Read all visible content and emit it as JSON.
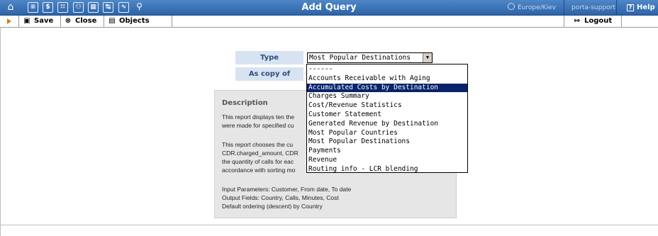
{
  "topbar": {
    "title": "Add Query",
    "timezone": "Europe/Kiev",
    "user": "porta-support",
    "help_label": "Help",
    "nav_icons": [
      "home-icon",
      "list-icon",
      "dollar-icon",
      "grid-icon",
      "user-icon",
      "table-icon",
      "transfer-icon",
      "chart-icon",
      "search-icon"
    ]
  },
  "toolbar": {
    "save_label": "Save",
    "close_label": "Close",
    "objects_label": "Objects",
    "logout_label": "Logout"
  },
  "form": {
    "type_label": "Type",
    "as_copy_label": "As copy of",
    "type_value": "Most Popular Destinations"
  },
  "dropdown": {
    "options": [
      "------",
      "Accounts Receivable with Aging",
      "Accumulated Costs by Destination",
      "Charges Summary",
      "Cost/Revenue Statistics",
      "Customer Statement",
      "Generated Revenue by Destination",
      "Most Popular Countries",
      "Most Popular Destinations",
      "Payments",
      "Revenue",
      "Routing info - LCR blending"
    ],
    "highlighted": "Accumulated Costs by Destination"
  },
  "description": {
    "title": "Description",
    "lines": [
      "This report displays ten the",
      "were made for specified cu",
      "",
      "This report chooses the cu",
      "CDR.charged_amount, CDR",
      "the quantity of calls for eac",
      "accordance with sorting mo",
      "",
      "Input Parameters: Customer, From date, To date",
      "Output Fields: Country, Calls, Minutes, Cost",
      "Default ordering (descent) by Country"
    ]
  },
  "colors": {
    "topbar": "#2d64a8",
    "label_bg": "#d7e3f1",
    "label_text": "#2e4e7e",
    "highlight": "#0a246a",
    "panel_bg": "#e6e6e6"
  }
}
